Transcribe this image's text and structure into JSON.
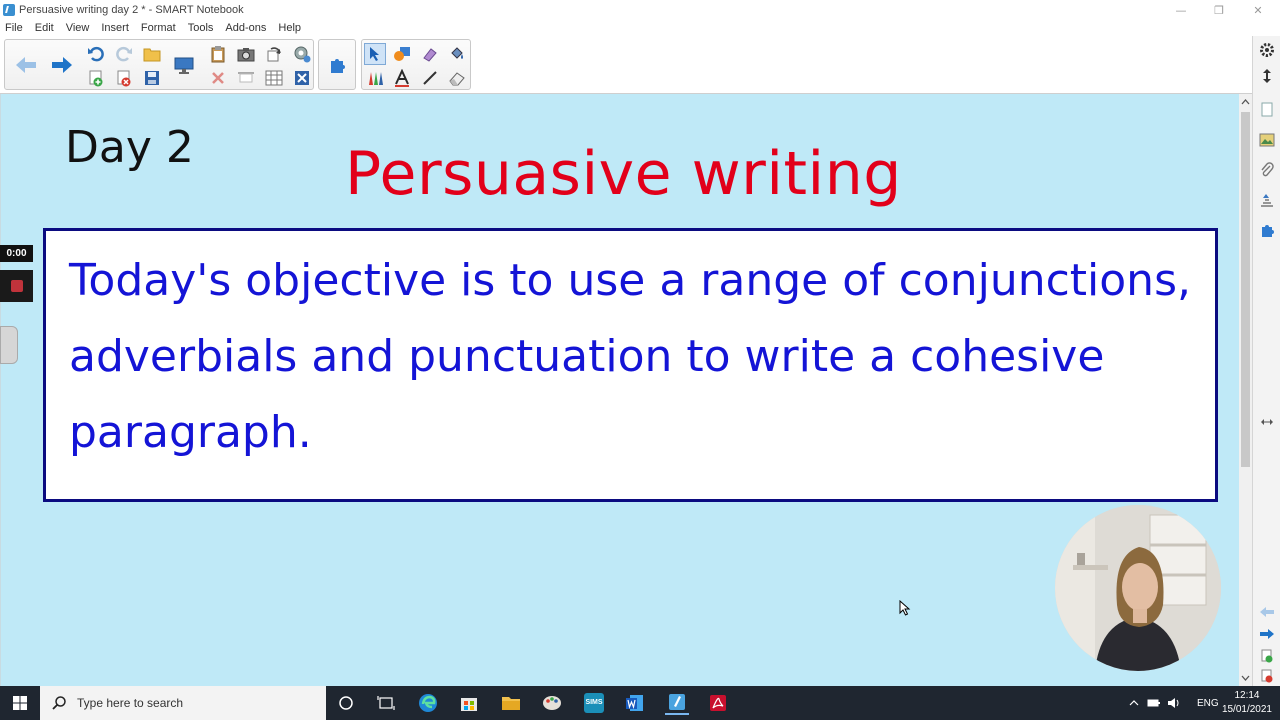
{
  "window": {
    "title": "Persuasive writing day 2 * - SMART Notebook",
    "minimize": "—",
    "restore": "❐",
    "close": "✕"
  },
  "menu": [
    "File",
    "Edit",
    "View",
    "Insert",
    "Format",
    "Tools",
    "Add-ons",
    "Help"
  ],
  "slide": {
    "day_label": "Day 2",
    "title": "Persuasive writing",
    "objective": "Today's objective is to use a range of conjunctions, adverbials and punctuation to write a cohesive paragraph."
  },
  "recording": {
    "time": "0:00"
  },
  "taskbar": {
    "search_placeholder": "Type here to search",
    "sims_label": "SIMS",
    "language": "ENG",
    "time": "12:14",
    "date": "15/01/2021"
  },
  "colors": {
    "canvas_bg": "#bfe9f7",
    "title_red": "#e2001a",
    "objective_blue": "#1414d6",
    "box_border": "#0b0b80"
  }
}
